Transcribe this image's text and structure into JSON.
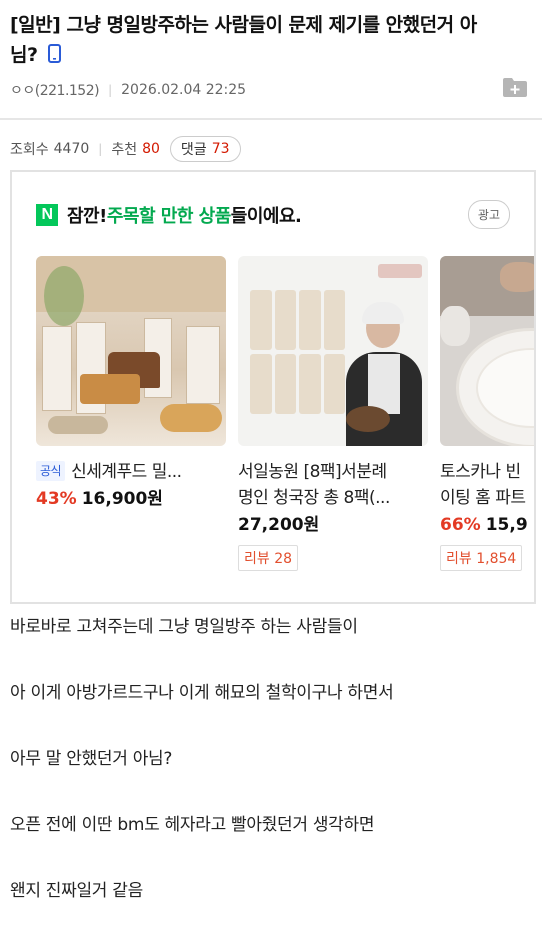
{
  "post": {
    "title_line1": "[일반] 그냥 명일방주하는 사람들이 문제 제기를 안했던거 아",
    "title_line2": "님?",
    "author": "ㅇㅇ(221.152)",
    "datetime": "2026.02.04 22:25",
    "views_label": "조회수",
    "views": "4470",
    "recommend_label": "추천",
    "recommend": "80",
    "comments_label": "댓글",
    "comments": "73"
  },
  "ad": {
    "logo_letter": "N",
    "heading_prefix": "잠깐! ",
    "heading_highlight": "주목할 만한 상품",
    "heading_suffix": "들이에요.",
    "badge": "광고",
    "products": [
      {
        "tag": "공식",
        "name_line1": "신세계푸드 밀...",
        "name_line2": "",
        "discount": "43%",
        "price": "16,900원",
        "review": ""
      },
      {
        "tag": "",
        "name_line1": "서일농원 [8팩]서분례",
        "name_line2": "명인 청국장 총 8팩(...",
        "discount": "",
        "price": "27,200원",
        "review": "리뷰 28"
      },
      {
        "tag": "",
        "name_line1": "토스카나 빈",
        "name_line2": "이팅 홈 파트",
        "discount": "66%",
        "price": "15,9",
        "review": "리뷰 1,854"
      }
    ]
  },
  "body": {
    "lines": [
      "바로바로 고쳐주는데 그냥 명일방주 하는 사람들이",
      "아 이게 아방가르드구나 이게 해묘의 철학이구나 하면서",
      "아무 말 안했던거 아님?",
      "오픈 전에 이딴 bm도 헤자라고 빨아줬던거 생각하면",
      "왠지 진짜일거 같음"
    ]
  },
  "colors": {
    "accent_red": "#d31900",
    "naver_green": "#03c75a",
    "discount_red": "#e33a24"
  }
}
